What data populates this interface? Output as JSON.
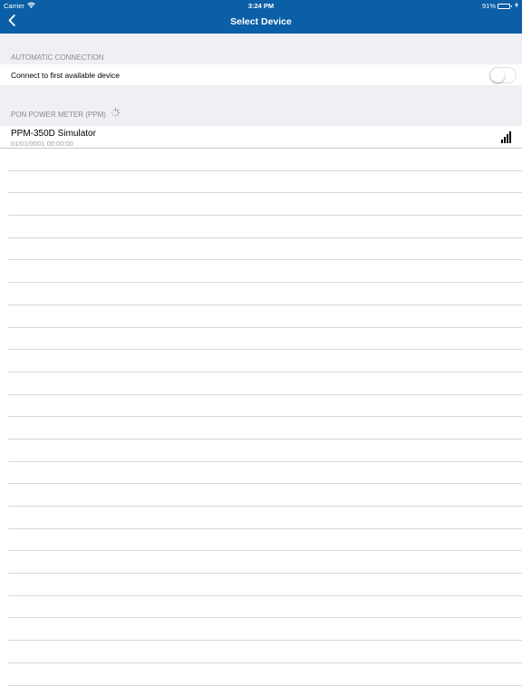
{
  "status_bar": {
    "carrier": "Carrier",
    "wifi_icon": "wifi-icon",
    "time": "3:24 PM",
    "battery_percent": "91%",
    "battery_level": 0.91,
    "battery_color": "#4cd964",
    "charging_icon": "bolt-icon"
  },
  "nav_bar": {
    "back_icon": "chevron-left-icon",
    "title": "Select Device",
    "color": "#0a5fa6"
  },
  "automatic_connection": {
    "header": "AUTOMATIC CONNECTION",
    "label": "Connect to first available device",
    "enabled": false
  },
  "devices_section": {
    "header": "PON POWER METER (PPM)",
    "spinner_icon": "activity-spinner-icon",
    "devices": [
      {
        "name": "PPM-350D Simulator",
        "date": "01/01/0001 00:00:00",
        "signal_icon": "signal-strength-icon",
        "signal_bars": 4
      }
    ]
  }
}
